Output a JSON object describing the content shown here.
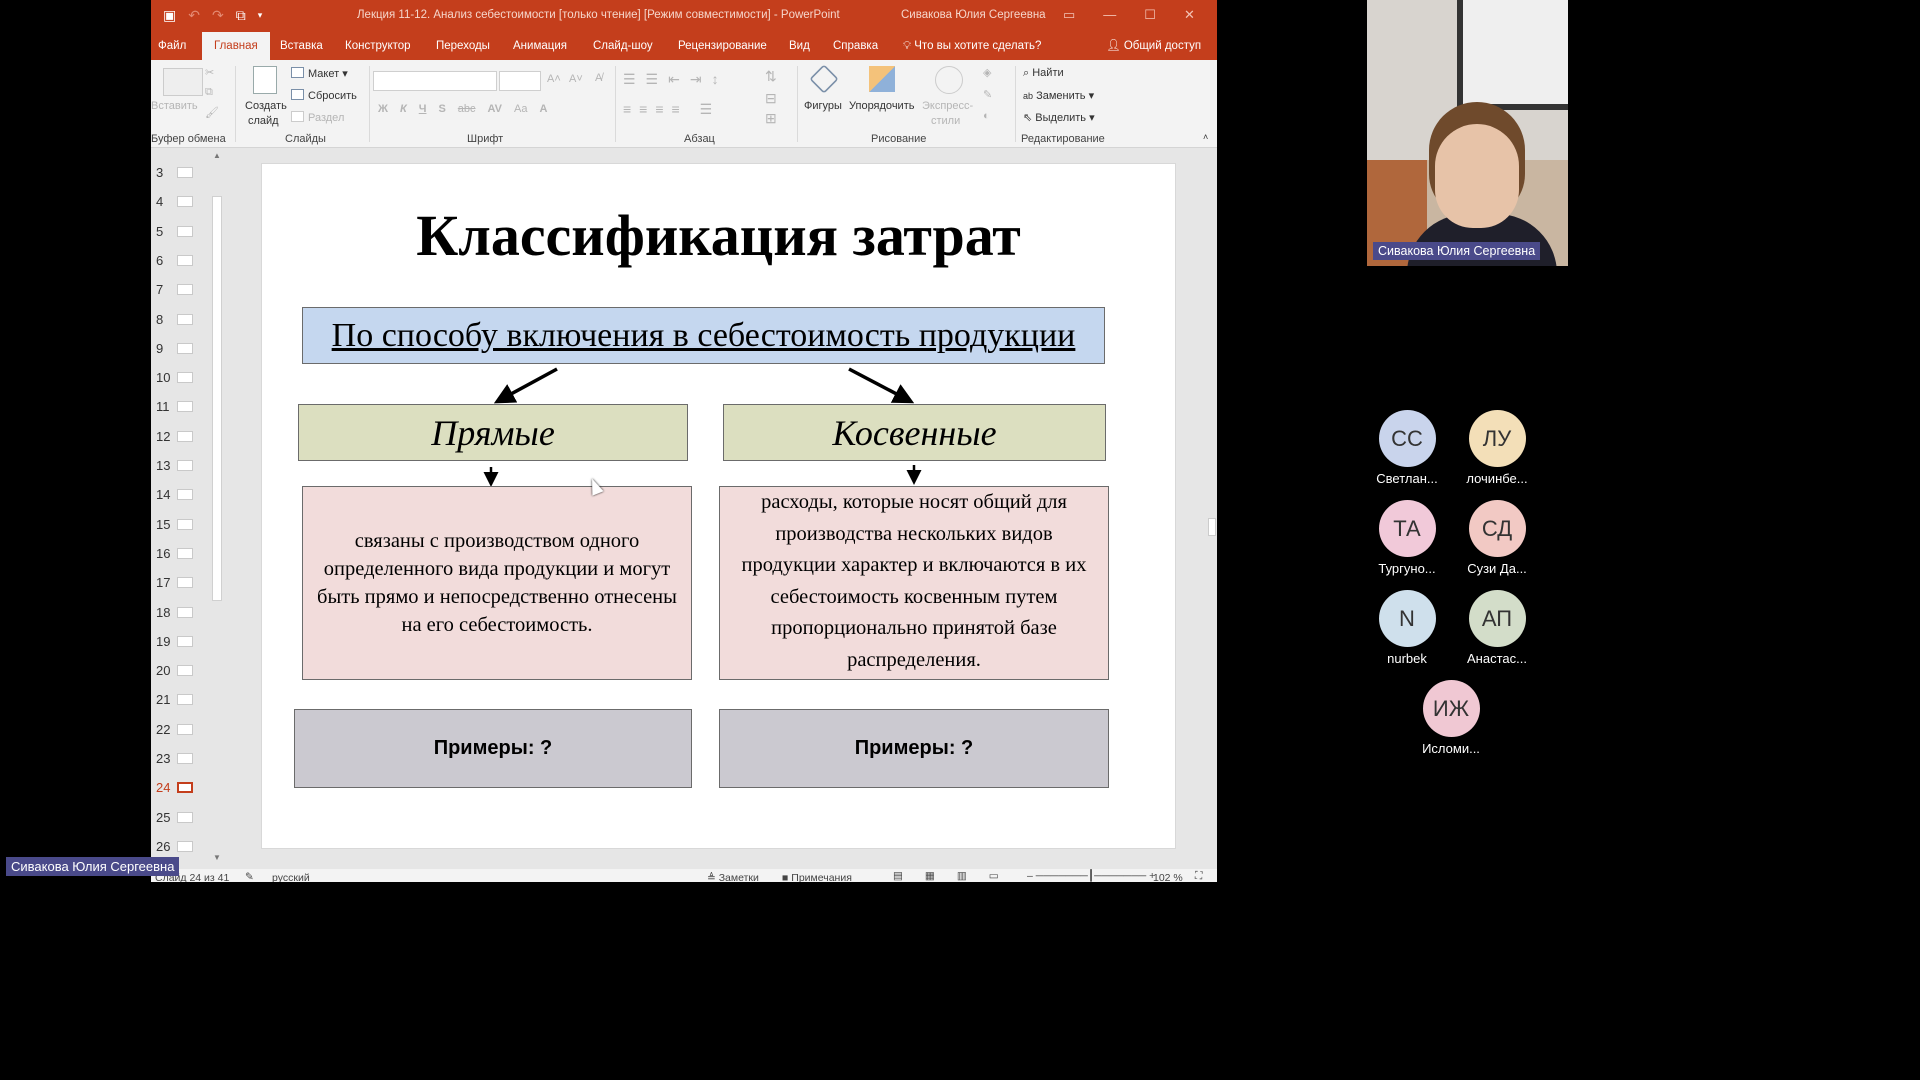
{
  "window": {
    "title": "Лекция 11-12. Анализ себестоимости [только чтение] [Режим совместимости]  -  PowerPoint",
    "user": "Сивакова Юлия Сергеевна",
    "accent": "#c43e1c"
  },
  "tabs": [
    {
      "label": "Файл"
    },
    {
      "label": "Главная"
    },
    {
      "label": "Вставка"
    },
    {
      "label": "Конструктор"
    },
    {
      "label": "Переходы"
    },
    {
      "label": "Анимация"
    },
    {
      "label": "Слайд-шоу"
    },
    {
      "label": "Рецензирование"
    },
    {
      "label": "Вид"
    },
    {
      "label": "Справка"
    },
    {
      "label": "Что вы хотите сделать?"
    },
    {
      "label": "Общий доступ"
    }
  ],
  "ribbon": {
    "paste": "Вставить",
    "new_slide_1": "Создать",
    "new_slide_2": "слайд",
    "layout": "Макет",
    "reset": "Сбросить",
    "section": "Раздел",
    "shapes": "Фигуры",
    "arrange": "Упорядочить",
    "quick_styles_1": "Экспресс-",
    "quick_styles_2": "стили",
    "find": "Найти",
    "replace": "Заменить",
    "select": "Выделить",
    "groups": {
      "clipboard": "Буфер обмена",
      "slides": "Слайды",
      "font": "Шрифт",
      "paragraph": "Абзац",
      "drawing": "Рисование",
      "editing": "Редактирование"
    },
    "font_buttons": [
      "Ж",
      "К",
      "Ч",
      "S",
      "abc",
      "AV",
      "Aa",
      "A"
    ]
  },
  "thumbnails": [
    "3",
    "4",
    "5",
    "6",
    "7",
    "8",
    "9",
    "10",
    "11",
    "12",
    "13",
    "14",
    "15",
    "16",
    "17",
    "18",
    "19",
    "20",
    "21",
    "22",
    "23",
    "24",
    "25",
    "26"
  ],
  "selected_slide": "24",
  "slide": {
    "title": "Классификация затрат",
    "top": "По способу включения в себестоимость продукции",
    "left_heading": "Прямые",
    "right_heading": "Косвенные",
    "left_desc": "связаны с производством  одного определенного вида продукции и могут быть прямо и непосредственно отнесены на его себестоимость.",
    "right_desc": "расходы, которые носят общий для производства нескольких видов продукции характер и включаются в их себестоимость косвенным путем пропорционально принятой базе распределения.",
    "left_examples": "Примеры: ?",
    "right_examples": "Примеры: ?"
  },
  "status": {
    "slide_info": "Слайд 24 из 41",
    "language": "русский",
    "notes": "Заметки",
    "comments": "Примечания",
    "zoom": "102 %"
  },
  "meeting": {
    "presenter": "Сивакова Юлия Сергеевна",
    "participants": [
      {
        "initials": "СС",
        "name": "Светлан...",
        "color": "#c9d4ec"
      },
      {
        "initials": "ЛУ",
        "name": "лочинбе...",
        "color": "#f3dfb8"
      },
      {
        "initials": "ТА",
        "name": "Тургуно...",
        "color": "#f1c9d9"
      },
      {
        "initials": "СД",
        "name": "Сузи Да...",
        "color": "#f2c9c4"
      },
      {
        "initials": "N",
        "name": "nurbek",
        "color": "#cfe0ec"
      },
      {
        "initials": "АП",
        "name": "Анастас...",
        "color": "#d3ddc9"
      },
      {
        "initials": "ИЖ",
        "name": "Исломи...",
        "color": "#f0c8d3"
      }
    ]
  }
}
